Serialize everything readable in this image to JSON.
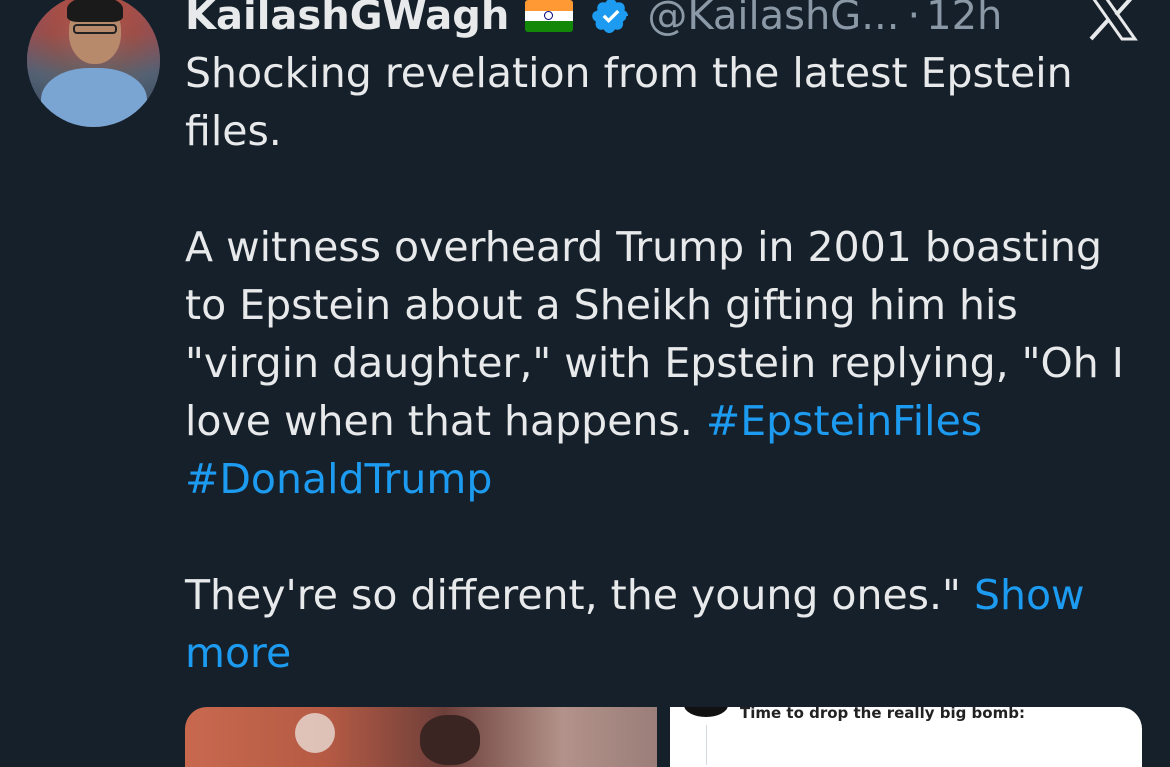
{
  "author": {
    "name": "KailashGWagh",
    "flag_icon": "india-flag-emoji",
    "verified_icon": "verified-badge-icon",
    "handle": "@KailashG...",
    "separator": "·",
    "time": "12h"
  },
  "tweet": {
    "p1": "Shocking revelation from the latest Epstein files.",
    "p2_text": "A witness overheard Trump in 2001 boasting to Epstein about a Sheikh gifting him his \"virgin daughter,\" with Epstein replying, \"Oh I love when that happens. ",
    "hashtag1": "#EpsteinFiles",
    "hashtag2": "#DonaldTrump",
    "p3_text": "They're so different, the young ones.\" ",
    "show_more": "Show more"
  },
  "media": {
    "right_caption": "Time to drop the really big bomb:"
  },
  "colors": {
    "background": "#15202b",
    "text": "#e7e9ea",
    "secondary": "#8b98a5",
    "link": "#1d9bf0"
  }
}
